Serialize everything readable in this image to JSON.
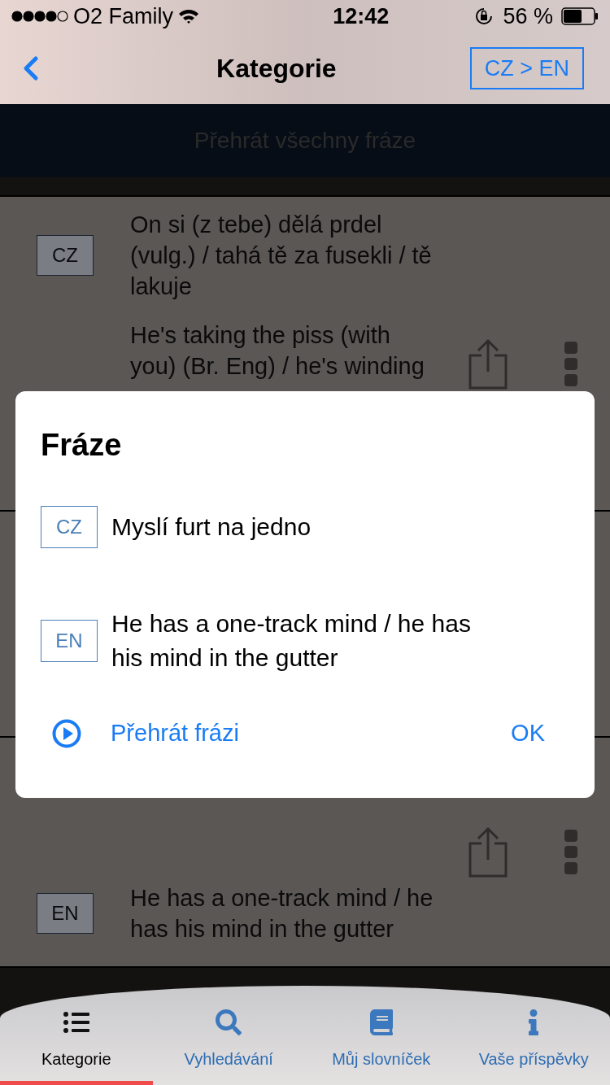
{
  "status_bar": {
    "carrier": "O2 Family",
    "time": "12:42",
    "battery": "56 %"
  },
  "nav": {
    "title": "Kategorie",
    "language_button": "CZ > EN"
  },
  "play_all": "Přehrát všechny fráze",
  "cards": [
    {
      "lines": [
        {
          "badge": "CZ",
          "text": "On si (z tebe) dělá prdel (vulg.) / tahá tě za fusekli / tě lakuje"
        },
        {
          "text": "He's taking the piss (with you) (Br. Eng) / he's winding"
        }
      ]
    },
    {
      "lines": [
        {
          "badge": "EN",
          "text": "He has a one-track mind / he has his mind in the gutter"
        }
      ]
    }
  ],
  "dialog": {
    "title": "Fráze",
    "rows": [
      {
        "badge": "CZ",
        "text": "Myslí furt na jedno"
      },
      {
        "badge": "EN",
        "text": "He has a one-track mind / he has his mind in the gutter"
      }
    ],
    "play": "Přehrát frázi",
    "ok": "OK"
  },
  "tabs": [
    {
      "label": "Kategorie",
      "kind": "list",
      "selected": true
    },
    {
      "label": "Vyhledávání",
      "kind": "search",
      "selected": false
    },
    {
      "label": "Můj slovníček",
      "kind": "book",
      "selected": false
    },
    {
      "label": "Vaše příspěvky",
      "kind": "info",
      "selected": false
    }
  ]
}
